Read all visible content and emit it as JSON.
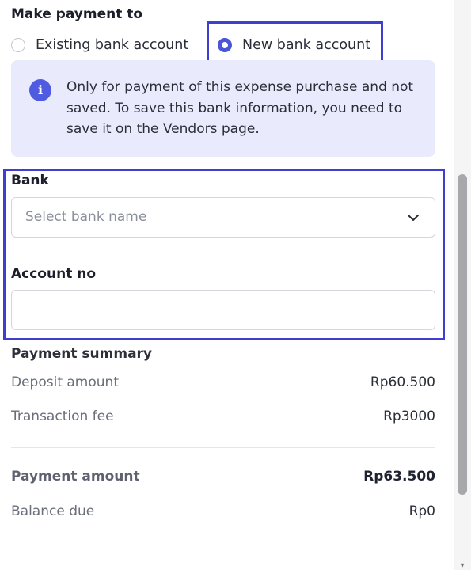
{
  "make_payment": {
    "title": "Make payment to",
    "options": [
      {
        "label": "Existing bank account",
        "selected": false
      },
      {
        "label": "New bank account",
        "selected": true
      }
    ]
  },
  "info": {
    "icon": "info-icon",
    "icon_glyph": "i",
    "text": "Only for payment of this expense purchase and not saved. To save this bank information, you need to save it on the Vendors page."
  },
  "bank": {
    "label": "Bank",
    "placeholder": "Select bank name",
    "value": ""
  },
  "account": {
    "label": "Account no",
    "value": "",
    "placeholder": ""
  },
  "summary": {
    "title": "Payment summary",
    "deposit_label": "Deposit amount",
    "deposit_value": "Rp60.500",
    "fee_label": "Transaction fee",
    "fee_value": "Rp3000",
    "payment_label": "Payment amount",
    "payment_value": "Rp63.500",
    "balance_label": "Balance due",
    "balance_value": "Rp0"
  },
  "colors": {
    "accent": "#4a55d8",
    "highlight_border": "#3e3fd0",
    "info_background": "#e9ebfc"
  }
}
